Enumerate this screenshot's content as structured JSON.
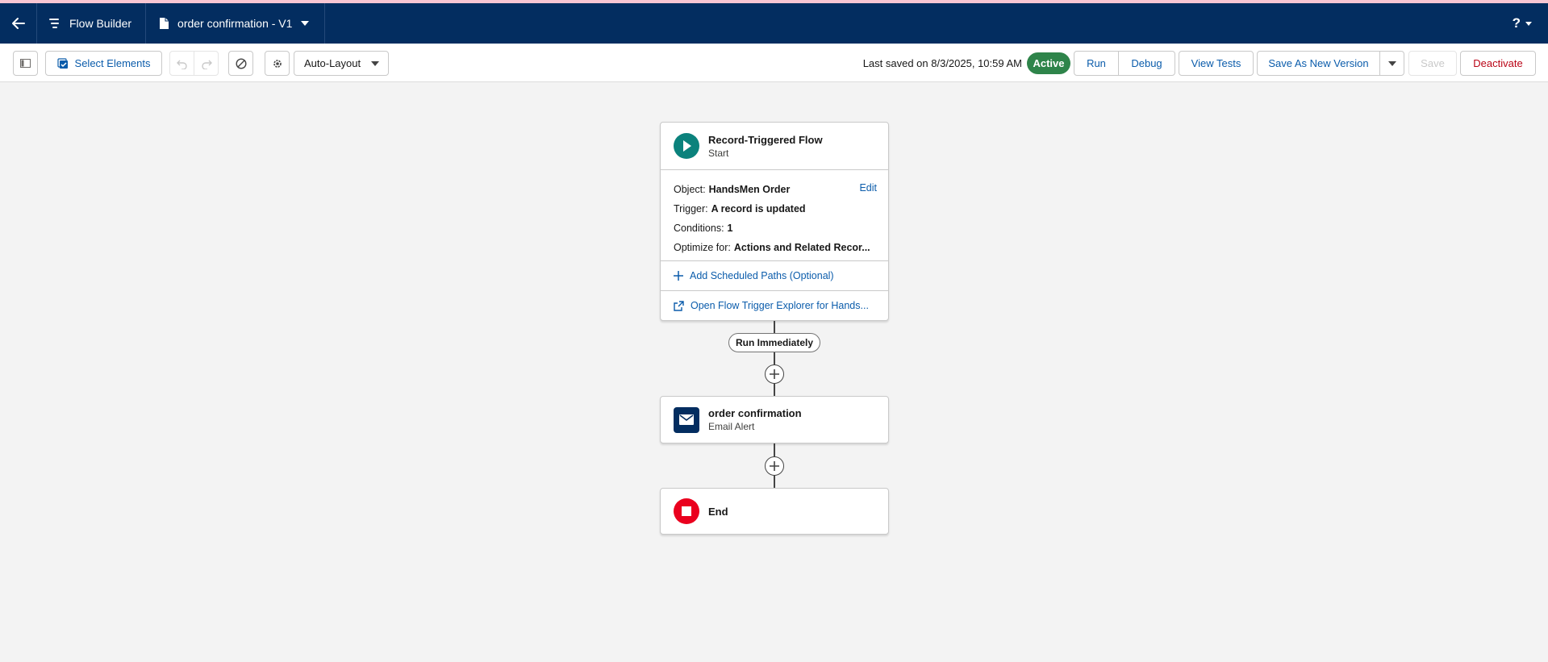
{
  "topbar": {
    "app_name": "Flow Builder",
    "file_name": "order confirmation - V1",
    "help_label": "?"
  },
  "toolbar": {
    "select_elements_label": "Select Elements",
    "layout_value": "Auto-Layout",
    "last_saved": "Last saved on 8/3/2025, 10:59 AM",
    "status_badge": "Active",
    "run_label": "Run",
    "debug_label": "Debug",
    "view_tests_label": "View Tests",
    "save_as_new_version_label": "Save As New Version",
    "save_label": "Save",
    "deactivate_label": "Deactivate"
  },
  "canvas": {
    "start": {
      "title": "Record-Triggered Flow",
      "subtitle": "Start",
      "edit_label": "Edit",
      "details": [
        {
          "label": "Object:",
          "value": "HandsMen Order"
        },
        {
          "label": "Trigger:",
          "value": "A record is updated"
        },
        {
          "label": "Conditions:",
          "value": "1"
        },
        {
          "label": "Optimize for:",
          "value": "Actions and Related Recor..."
        }
      ],
      "add_scheduled_paths": "Add Scheduled Paths (Optional)",
      "open_explorer": "Open Flow Trigger Explorer for Hands..."
    },
    "run_immediately": "Run Immediately",
    "email_node": {
      "title": "order confirmation",
      "subtitle": "Email Alert"
    },
    "end_node": {
      "title": "End"
    }
  },
  "colors": {
    "header_bg": "#032d60",
    "link": "#0b5cab",
    "active_badge": "#2e844a",
    "start_icon": "#0b827c",
    "end_icon": "#ea001e",
    "deactivate": "#ba0517"
  }
}
